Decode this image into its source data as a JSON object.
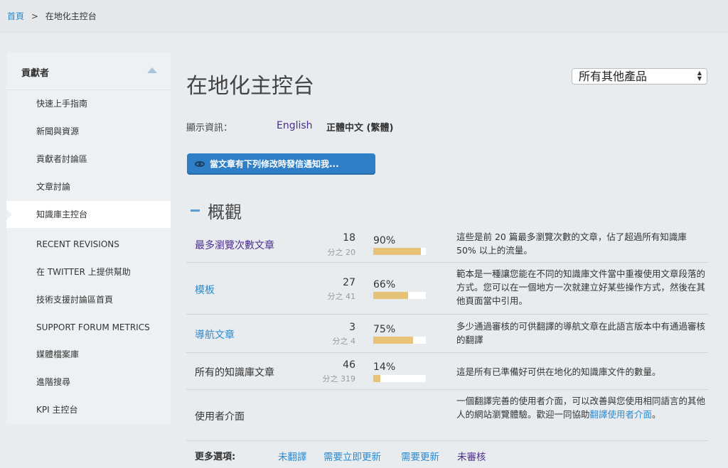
{
  "breadcrumb": {
    "home": "首頁",
    "separator": ">",
    "current": "在地化主控台"
  },
  "sidebar": {
    "title": "貢獻者",
    "items": [
      {
        "label": "快速上手指南"
      },
      {
        "label": "新聞與資源"
      },
      {
        "label": "貢獻者討論區"
      },
      {
        "label": "文章討論"
      },
      {
        "label": "知識庫主控台",
        "active": true
      },
      {
        "label": "RECENT REVISIONS"
      },
      {
        "label": "在 TWITTER 上提供幫助"
      },
      {
        "label": "技術支援討論區首頁"
      },
      {
        "label": "SUPPORT FORUM METRICS"
      },
      {
        "label": "媒體檔案庫"
      },
      {
        "label": "進階搜尋"
      },
      {
        "label": "KPI 主控台"
      }
    ]
  },
  "main": {
    "title": "在地化主控台",
    "product_select": "所有其他產品",
    "display_label": "顯示資訊：",
    "lang_en": "English",
    "lang_zh": "正體中文 (繁體)",
    "notify_button": "當文章有下列修改時發信通知我...",
    "overview_title": "概觀"
  },
  "overview_rows": [
    {
      "name": "最多瀏覽次數文章",
      "count": "18",
      "of": "分之 20",
      "pct": "90%",
      "fraction": 0.9,
      "desc": "這些是前 20 篇最多瀏覽次數的文章，佔了超過所有知識庫 50% 以上的流量。"
    },
    {
      "name": "模板",
      "count": "27",
      "of": "分之 41",
      "pct": "66%",
      "fraction": 0.66,
      "desc": "範本是一種讓您能在不同的知識庫文件當中重複使用文章段落的方式。您可以在一個地方一次就建立好某些操作方式，然後在其他頁面當中引用。"
    },
    {
      "name": "導航文章",
      "count": "3",
      "of": "分之 4",
      "pct": "75%",
      "fraction": 0.75,
      "desc": "多少通過審核的可供翻譯的導航文章在此語言版本中有通過審核的翻譯"
    },
    {
      "name": "所有的知識庫文章",
      "count": "46",
      "of": "分之 319",
      "pct": "14%",
      "fraction": 0.14,
      "desc": "這是所有已準備好可供在地化的知識庫文件的數量。"
    },
    {
      "name": "使用者介面",
      "desc_before": "一個翻譯完善的使用者介面，可以改善與您使用相同語言的其他人的網站瀏覽體驗。歡迎一同協助",
      "desc_link": "翻譯使用者介面",
      "desc_after": "。"
    }
  ],
  "more_options": {
    "label": "更多選項:",
    "items": [
      "未翻譯",
      "需要立即更新",
      "需要更新",
      "未審核"
    ]
  },
  "colors": {
    "link": "#2a8bd0",
    "visited": "#4b2d8f",
    "button": "#2f7fc7",
    "bar_fill": "#e8c276"
  }
}
